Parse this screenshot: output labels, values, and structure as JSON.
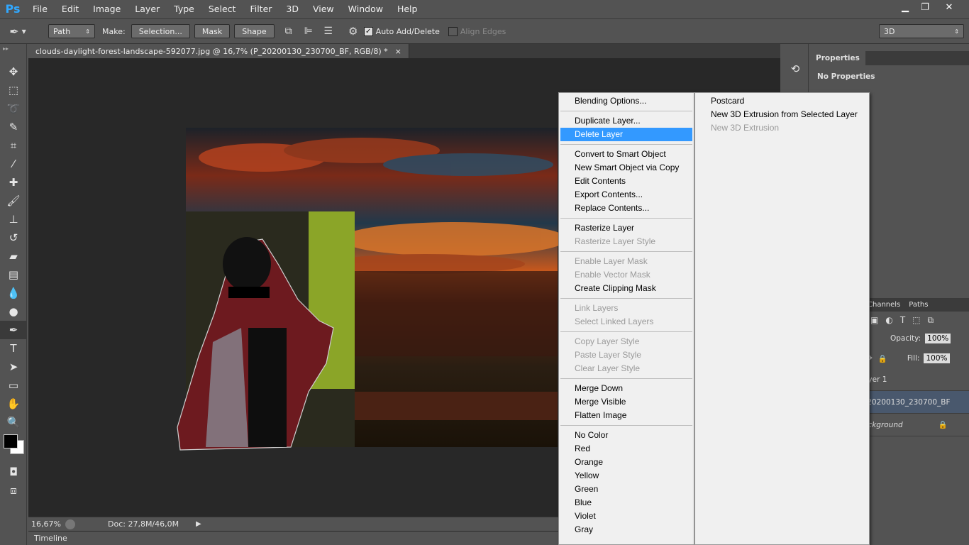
{
  "app": {
    "logo": "Ps"
  },
  "menubar": {
    "items": [
      "File",
      "Edit",
      "Image",
      "Layer",
      "Type",
      "Select",
      "Filter",
      "3D",
      "View",
      "Window",
      "Help"
    ]
  },
  "window_controls": {
    "minimize": "▁",
    "restore": "❐",
    "close": "✕"
  },
  "options": {
    "mode": "Path",
    "make_label": "Make:",
    "selection_btn": "Selection...",
    "mask_btn": "Mask",
    "shape_btn": "Shape",
    "auto_add_delete": "Auto Add/Delete",
    "auto_add_delete_checked": true,
    "align_edges": "Align Edges",
    "align_edges_checked": false,
    "workspace": "3D"
  },
  "document": {
    "tab_title": "clouds-daylight-forest-landscape-592077.jpg @ 16,7% (P_20200130_230700_BF, RGB/8) *",
    "tab_close": "×"
  },
  "status": {
    "zoom": "16,67%",
    "doc": "Doc: 27,8M/46,0M"
  },
  "timeline": {
    "label": "Timeline"
  },
  "properties": {
    "tab": "Properties",
    "content": "No Properties"
  },
  "layers_panel": {
    "tabs": [
      "Channels",
      "Paths"
    ],
    "opacity_label": "Opacity:",
    "opacity_value": "100%",
    "fill_label": "Fill:",
    "fill_value": "100%",
    "layers": [
      {
        "name": "ayer 1"
      },
      {
        "name": "_20200130_230700_BF"
      },
      {
        "name": "ackground"
      }
    ]
  },
  "context_menu": {
    "groups": [
      [
        {
          "label": "Blending Options...",
          "enabled": true
        }
      ],
      [
        {
          "label": "Duplicate Layer...",
          "enabled": true
        },
        {
          "label": "Delete Layer",
          "enabled": true,
          "highlighted": true
        }
      ],
      [
        {
          "label": "Convert to Smart Object",
          "enabled": true
        },
        {
          "label": "New Smart Object via Copy",
          "enabled": true
        },
        {
          "label": "Edit Contents",
          "enabled": true
        },
        {
          "label": "Export Contents...",
          "enabled": true
        },
        {
          "label": "Replace Contents...",
          "enabled": true
        }
      ],
      [
        {
          "label": "Rasterize Layer",
          "enabled": true
        },
        {
          "label": "Rasterize Layer Style",
          "enabled": false
        }
      ],
      [
        {
          "label": "Enable Layer Mask",
          "enabled": false
        },
        {
          "label": "Enable Vector Mask",
          "enabled": false
        },
        {
          "label": "Create Clipping Mask",
          "enabled": true
        }
      ],
      [
        {
          "label": "Link Layers",
          "enabled": false
        },
        {
          "label": "Select Linked Layers",
          "enabled": false
        }
      ],
      [
        {
          "label": "Copy Layer Style",
          "enabled": false
        },
        {
          "label": "Paste Layer Style",
          "enabled": false
        },
        {
          "label": "Clear Layer Style",
          "enabled": false
        }
      ],
      [
        {
          "label": "Merge Down",
          "enabled": true
        },
        {
          "label": "Merge Visible",
          "enabled": true
        },
        {
          "label": "Flatten Image",
          "enabled": true
        }
      ],
      [
        {
          "label": "No Color",
          "enabled": true
        },
        {
          "label": "Red",
          "enabled": true
        },
        {
          "label": "Orange",
          "enabled": true
        },
        {
          "label": "Yellow",
          "enabled": true
        },
        {
          "label": "Green",
          "enabled": true
        },
        {
          "label": "Blue",
          "enabled": true
        },
        {
          "label": "Violet",
          "enabled": true
        },
        {
          "label": "Gray",
          "enabled": true
        }
      ]
    ],
    "submenu": [
      {
        "label": "Postcard",
        "enabled": true
      },
      {
        "label": "New 3D Extrusion from Selected Layer",
        "enabled": true
      },
      {
        "label": "New 3D Extrusion",
        "enabled": false
      }
    ]
  },
  "colors": {
    "highlight": "#3399ff",
    "ui_bg": "#535353",
    "canvas_bg": "#282828"
  }
}
